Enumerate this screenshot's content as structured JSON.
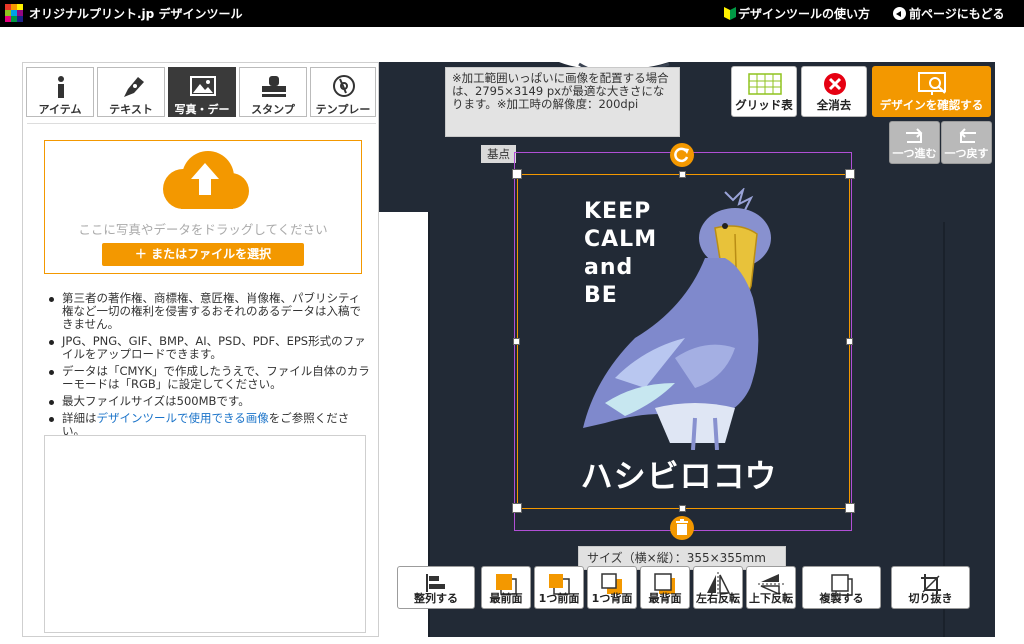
{
  "header": {
    "logo": "オリジナルプリント.jp デザインツール",
    "howto": "デザインツールの使い方",
    "back": "前ページにもどる"
  },
  "tabs": [
    {
      "label": "アイテム",
      "icon": "info-icon"
    },
    {
      "label": "テキスト",
      "icon": "pen-icon"
    },
    {
      "label": "写真・デー",
      "icon": "photo-icon",
      "active": true
    },
    {
      "label": "スタンプ",
      "icon": "stamp-icon"
    },
    {
      "label": "テンプレー",
      "icon": "template-icon"
    }
  ],
  "upload": {
    "drop_text": "ここに写真やデータをドラッグしてください",
    "button": "＋ またはファイルを選択"
  },
  "notes": {
    "n1": "第三者の著作権、商標権、意匠権、肖像権、パブリシティ権など一切の権利を侵害するおそれのあるデータは入稿できません。",
    "n2": "JPG、PNG、GIF、BMP、AI、PSD、PDF、EPS形式のファイルをアップロードできます。",
    "n3": "データは「CMYK」で作成したうえで、ファイル自体のカラーモードは「RGB」に設定してください。",
    "n4": "最大ファイルサイズは500MBです。",
    "n5_prefix": "詳細は",
    "n5_link": "デザインツールで使用できる画像",
    "n5_suffix": "をご参照ください。"
  },
  "canvas": {
    "info": "※加工範囲いっぱいに画像を配置する場合は、2795×3149 pxが最適な大きさになります。※加工時の解像度：200dpi",
    "kiten": "基点",
    "design_lines": [
      "KEEP",
      "CALM",
      "and",
      "BE"
    ],
    "design_kana": "ハシビロコウ",
    "size": "サイズ（横×縦）：355×355mm",
    "shirt_color": "#222a36",
    "accent": "#f39800"
  },
  "toolbar_top": {
    "grid": "グリッド表",
    "clear": "全消去",
    "confirm": "デザインを確認する",
    "redo": "一つ進む",
    "undo": "一つ戻す"
  },
  "toolbar_bottom": {
    "align": "整列する",
    "front": "最前面",
    "forward": "1つ前面",
    "backward": "1つ背面",
    "back": "最背面",
    "flip_h": "左右反転",
    "flip_v": "上下反転",
    "duplicate": "複製する",
    "crop": "切り抜き"
  }
}
